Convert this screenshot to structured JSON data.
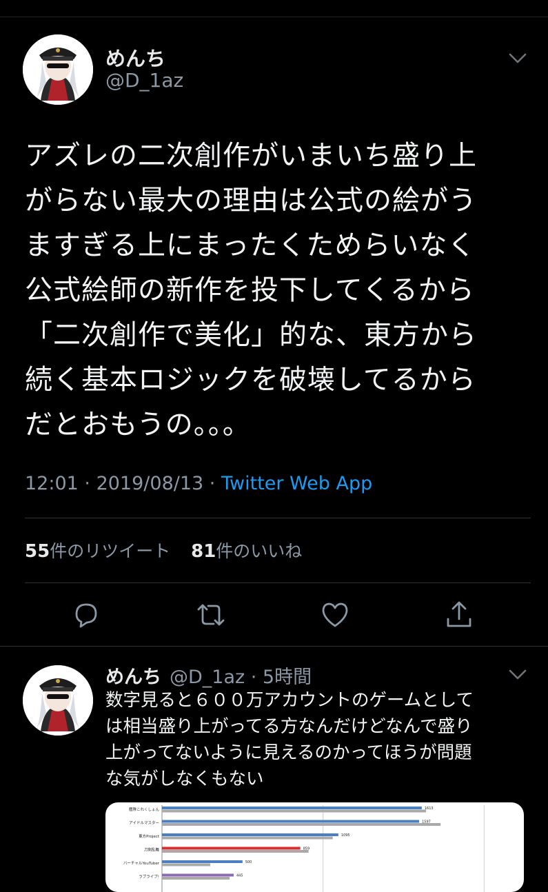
{
  "tweet": {
    "display_name": "めんち",
    "handle": "@D_1az",
    "lines": [
      "アズレの二次創作がいまいち盛り上",
      "がらない最大の理由は公式の絵がう",
      "ますぎる上にまったくためらいなく",
      "公式絵師の新作を投下してくるから",
      "「二次創作で美化」的な、東方から",
      "続く基本ロジックを破壊してるから",
      "だとおもうの。。。"
    ],
    "time": "12:01",
    "date": "2019/08/13",
    "app": "Twitter Web App",
    "retweet_count": "55",
    "retweet_label": "件のリツイート",
    "like_count": "81",
    "like_label": "件のいいね"
  },
  "actions": [
    {
      "icon": "reply-icon"
    },
    {
      "icon": "retweet-icon"
    },
    {
      "icon": "like-icon"
    },
    {
      "icon": "share-icon"
    }
  ],
  "reply": {
    "display_name": "めんち",
    "meta": "@D_1az · 5時間",
    "lines": [
      "数字見ると６００万アカウントのゲームとして",
      "は相当盛り上がってる方なんだけどなんで盛り",
      "上がってないように見えるのかってほうが問題",
      "な気がしなくもない"
    ]
  },
  "colors": {
    "background": "#000000",
    "text": "#e7e9ea",
    "muted": "#8b98a5",
    "link": "#1d9bf0",
    "divider": "#2f3336"
  },
  "chart_data": {
    "type": "bar",
    "categories": [
      "艦隊これくしょん",
      "アイドルマスター",
      "東方Project",
      "刀剣乱舞",
      "バーチャルYouTuber",
      "ラブライブ!"
    ],
    "series": [
      {
        "values": [
          1613,
          1597,
          1095,
          859,
          500,
          445
        ]
      },
      {
        "values": [
          1640,
          1730,
          1060,
          910,
          300,
          420
        ]
      }
    ],
    "data_labels": [
      "1613",
      "1597",
      "1095",
      "859",
      "500",
      "445"
    ],
    "colors": [
      "#4a7fc1",
      "#a9a9a9",
      "#d92c2c",
      "#8e6ab0"
    ],
    "xlim": [
      0,
      2200
    ]
  }
}
